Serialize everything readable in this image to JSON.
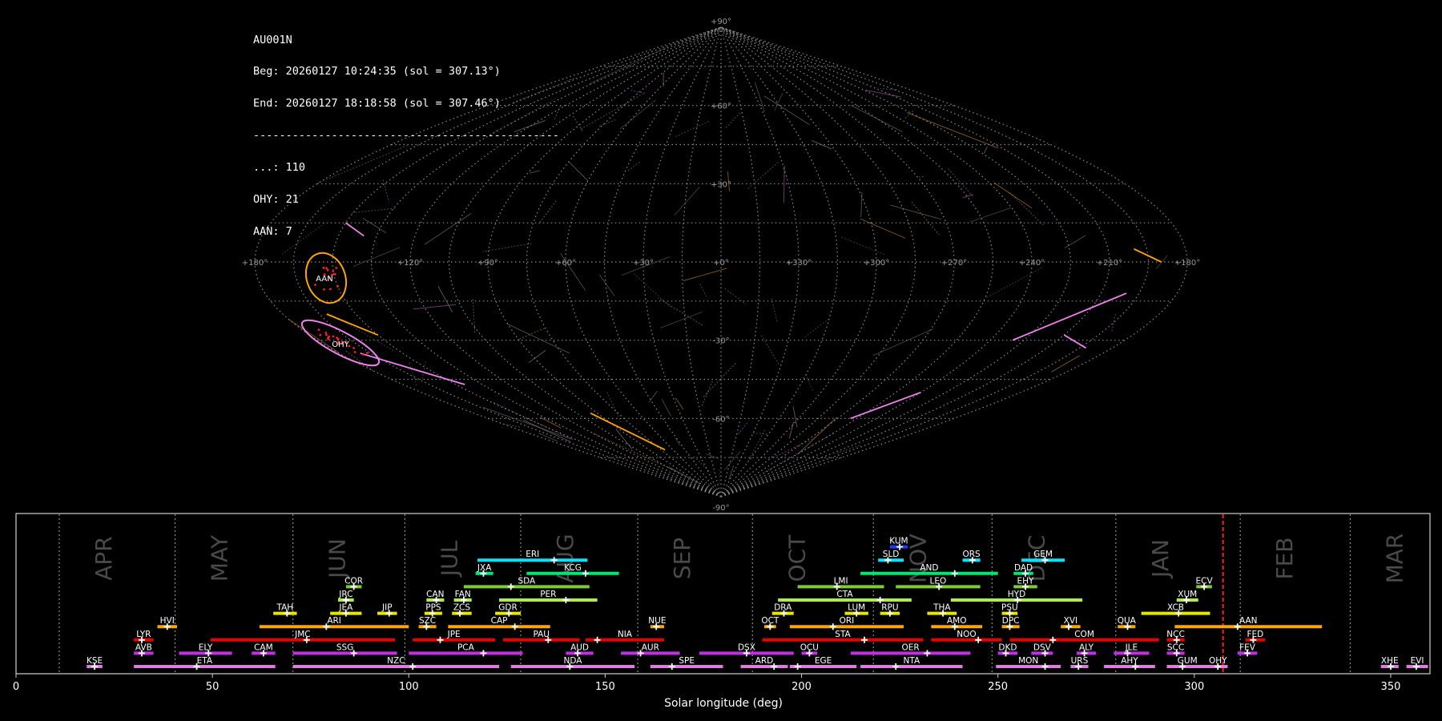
{
  "info": {
    "station": "AU001N",
    "begin": "Beg: 20260127 10:24:35 (sol = 307.13°)",
    "end": "End: 20260127 18:18:58 (sol = 307.46°)",
    "separator": "-----------------------------------------------",
    "counts": [
      "...: 110",
      "OHY: 21",
      "AAN: 7"
    ]
  },
  "sky_map": {
    "projection": "sinusoidal",
    "lon_labels": [
      "+180°",
      "+120°",
      "+90°",
      "+60°",
      "+30°",
      "+0°",
      "+330°",
      "+300°",
      "+270°",
      "+240°",
      "+210°",
      "+180°"
    ],
    "lat_labels": [
      "+90°",
      "+60°",
      "+30°",
      "-30°",
      "-60°",
      "-90°"
    ],
    "shower_markers": [
      {
        "code": "AAN",
        "color": "#ffa500"
      },
      {
        "code": "OHY",
        "color": "#ee82ee"
      }
    ]
  },
  "chart_data": {
    "type": "timeline",
    "xlabel": "Solar longitude (deg)",
    "xlim": [
      0,
      360
    ],
    "xticks": [
      0,
      50,
      100,
      150,
      200,
      250,
      300,
      350
    ],
    "current_sol": 307.3,
    "months": [
      {
        "name": "APR",
        "start": 11
      },
      {
        "name": "MAY",
        "start": 40.5
      },
      {
        "name": "JUN",
        "start": 70.5
      },
      {
        "name": "JUL",
        "start": 99
      },
      {
        "name": "AUG",
        "start": 128.5
      },
      {
        "name": "SEP",
        "start": 158.3
      },
      {
        "name": "OCT",
        "start": 187.5
      },
      {
        "name": "NOV",
        "start": 218.3
      },
      {
        "name": "DEC",
        "start": 248.5
      },
      {
        "name": "JAN",
        "start": 280
      },
      {
        "name": "FEB",
        "start": 311.7
      },
      {
        "name": "MAR",
        "start": 339.7
      }
    ],
    "showers": [
      {
        "code": "KUM",
        "start": 222.5,
        "end": 227,
        "peak": 225,
        "row": 10,
        "color": "#1e3cff"
      },
      {
        "code": "ERI",
        "start": 117.5,
        "end": 145.5,
        "peak": 137,
        "row": 9,
        "color": "#00e5ff"
      },
      {
        "code": "SLD",
        "start": 219.5,
        "end": 226,
        "peak": 222,
        "row": 9,
        "color": "#00e5ff"
      },
      {
        "code": "ORS",
        "start": 241,
        "end": 245.5,
        "peak": 243.5,
        "row": 9,
        "color": "#00e5ff"
      },
      {
        "code": "GEM",
        "start": 256,
        "end": 267,
        "peak": 262,
        "row": 9,
        "color": "#00e5ff"
      },
      {
        "code": "JXA",
        "start": 117,
        "end": 121.5,
        "peak": 119,
        "row": 8,
        "color": "#00e676"
      },
      {
        "code": "KCG",
        "start": 130,
        "end": 153.5,
        "peak": 145,
        "row": 8,
        "color": "#00e676"
      },
      {
        "code": "AND",
        "start": 215,
        "end": 250,
        "peak": 239,
        "row": 8,
        "color": "#00e676"
      },
      {
        "code": "DAD",
        "start": 254,
        "end": 259,
        "peak": 257,
        "row": 8,
        "color": "#00e676"
      },
      {
        "code": "COR",
        "start": 84,
        "end": 88,
        "peak": 86,
        "row": 7,
        "color": "#7ccd32"
      },
      {
        "code": "SDA",
        "start": 114,
        "end": 146,
        "peak": 126,
        "row": 7,
        "color": "#7ccd32"
      },
      {
        "code": "LMI",
        "start": 199,
        "end": 221,
        "peak": 209,
        "row": 7,
        "color": "#7ccd32"
      },
      {
        "code": "LEO",
        "start": 224,
        "end": 245.5,
        "peak": 235,
        "row": 7,
        "color": "#7ccd32"
      },
      {
        "code": "EHY",
        "start": 254,
        "end": 260,
        "peak": 257,
        "row": 7,
        "color": "#7ccd32"
      },
      {
        "code": "ECV",
        "start": 300.5,
        "end": 304.5,
        "peak": 302.5,
        "row": 7,
        "color": "#7ccd32"
      },
      {
        "code": "JRC",
        "start": 82,
        "end": 86,
        "peak": 84,
        "row": 6,
        "color": "#a8f045"
      },
      {
        "code": "CAN",
        "start": 104.5,
        "end": 109,
        "peak": 107,
        "row": 6,
        "color": "#a8f045"
      },
      {
        "code": "FAN",
        "start": 111.5,
        "end": 116,
        "peak": 114,
        "row": 6,
        "color": "#a8f045"
      },
      {
        "code": "PER",
        "start": 123,
        "end": 148,
        "peak": 140,
        "row": 6,
        "color": "#a8f045"
      },
      {
        "code": "CTA",
        "start": 194,
        "end": 228,
        "peak": 220,
        "row": 6,
        "color": "#a8f045"
      },
      {
        "code": "HYD",
        "start": 238,
        "end": 271.5,
        "peak": 255,
        "row": 6,
        "color": "#a8f045"
      },
      {
        "code": "XUM",
        "start": 295.5,
        "end": 301,
        "peak": 298,
        "row": 6,
        "color": "#a8f045"
      },
      {
        "code": "TAH",
        "start": 65.5,
        "end": 71.5,
        "peak": 69,
        "row": 5,
        "color": "#e6e600"
      },
      {
        "code": "JEA",
        "start": 80,
        "end": 88,
        "peak": 84,
        "row": 5,
        "color": "#e6e600"
      },
      {
        "code": "JIP",
        "start": 92,
        "end": 97,
        "peak": 95,
        "row": 5,
        "color": "#e6e600"
      },
      {
        "code": "PPS",
        "start": 104,
        "end": 108.5,
        "peak": 106,
        "row": 5,
        "color": "#e6e600"
      },
      {
        "code": "ZCS",
        "start": 111,
        "end": 116,
        "peak": 113,
        "row": 5,
        "color": "#e6e600"
      },
      {
        "code": "GDR",
        "start": 122,
        "end": 128.5,
        "peak": 125.5,
        "row": 5,
        "color": "#e6e600"
      },
      {
        "code": "DRA",
        "start": 192.5,
        "end": 198,
        "peak": 195.5,
        "row": 5,
        "color": "#e6e600"
      },
      {
        "code": "LUM",
        "start": 211,
        "end": 217,
        "peak": 214,
        "row": 5,
        "color": "#e6e600"
      },
      {
        "code": "RPU",
        "start": 220,
        "end": 225,
        "peak": 222.5,
        "row": 5,
        "color": "#e6e600"
      },
      {
        "code": "THA",
        "start": 232,
        "end": 239.5,
        "peak": 236,
        "row": 5,
        "color": "#e6e600"
      },
      {
        "code": "PSU",
        "start": 251,
        "end": 255,
        "peak": 253,
        "row": 5,
        "color": "#e6e600"
      },
      {
        "code": "XCB",
        "start": 286.5,
        "end": 304,
        "peak": 296,
        "row": 5,
        "color": "#e6e600"
      },
      {
        "code": "HVI",
        "start": 36,
        "end": 41,
        "peak": 38.5,
        "row": 4,
        "color": "#ffa500"
      },
      {
        "code": "ARI",
        "start": 62,
        "end": 100,
        "peak": 79,
        "row": 4,
        "color": "#ffa500"
      },
      {
        "code": "SZC",
        "start": 102.5,
        "end": 107,
        "peak": 104.5,
        "row": 4,
        "color": "#ffa500"
      },
      {
        "code": "CAP",
        "start": 110,
        "end": 136,
        "peak": 127,
        "row": 4,
        "color": "#ffa500"
      },
      {
        "code": "NUE",
        "start": 161.5,
        "end": 165,
        "peak": 163,
        "row": 4,
        "color": "#ffa500"
      },
      {
        "code": "OCT",
        "start": 190.5,
        "end": 193.5,
        "peak": 192,
        "row": 4,
        "color": "#ffa500"
      },
      {
        "code": "ORI",
        "start": 197,
        "end": 226,
        "peak": 208,
        "row": 4,
        "color": "#ffa500"
      },
      {
        "code": "AMO",
        "start": 233,
        "end": 246,
        "peak": 239,
        "row": 4,
        "color": "#ffa500"
      },
      {
        "code": "DPC",
        "start": 251,
        "end": 255.5,
        "peak": 253,
        "row": 4,
        "color": "#ffa500"
      },
      {
        "code": "XVI",
        "start": 266,
        "end": 271,
        "peak": 268,
        "row": 4,
        "color": "#ffa500"
      },
      {
        "code": "QUA",
        "start": 280.5,
        "end": 285,
        "peak": 283,
        "row": 4,
        "color": "#ffa500"
      },
      {
        "code": "AAN",
        "start": 295,
        "end": 332.5,
        "peak": 311,
        "row": 4,
        "color": "#ffa500"
      },
      {
        "code": "LYR",
        "start": 30,
        "end": 35,
        "peak": 32,
        "row": 3,
        "color": "#e60000"
      },
      {
        "code": "JMC",
        "start": 49.5,
        "end": 96.5,
        "peak": 74,
        "row": 3,
        "color": "#e60000"
      },
      {
        "code": "JPE",
        "start": 101,
        "end": 122,
        "peak": 108,
        "row": 3,
        "color": "#e60000"
      },
      {
        "code": "PAU",
        "start": 124,
        "end": 143.5,
        "peak": 135.5,
        "row": 3,
        "color": "#e60000"
      },
      {
        "code": "NIA",
        "start": 145,
        "end": 165,
        "peak": 148,
        "row": 3,
        "color": "#e60000"
      },
      {
        "code": "STA",
        "start": 190,
        "end": 231,
        "peak": 216,
        "row": 3,
        "color": "#e60000"
      },
      {
        "code": "NOO",
        "start": 233,
        "end": 251,
        "peak": 245,
        "row": 3,
        "color": "#e60000"
      },
      {
        "code": "COM",
        "start": 253,
        "end": 291,
        "peak": 264,
        "row": 3,
        "color": "#e60000"
      },
      {
        "code": "NCC",
        "start": 293,
        "end": 297.5,
        "peak": 295.5,
        "row": 3,
        "color": "#e60000"
      },
      {
        "code": "FED",
        "start": 313,
        "end": 318,
        "peak": 315,
        "row": 3,
        "color": "#e60000"
      },
      {
        "code": "AVB",
        "start": 30,
        "end": 35,
        "peak": 32,
        "row": 2,
        "color": "#c030e0"
      },
      {
        "code": "ELY",
        "start": 41.5,
        "end": 55,
        "peak": 49,
        "row": 2,
        "color": "#c030e0"
      },
      {
        "code": "CAM",
        "start": 60,
        "end": 66,
        "peak": 63,
        "row": 2,
        "color": "#c030e0"
      },
      {
        "code": "SSG",
        "start": 70.5,
        "end": 97,
        "peak": 86,
        "row": 2,
        "color": "#c030e0"
      },
      {
        "code": "PCA",
        "start": 100,
        "end": 129,
        "peak": 119,
        "row": 2,
        "color": "#c030e0"
      },
      {
        "code": "AUD",
        "start": 140,
        "end": 147,
        "peak": 143,
        "row": 2,
        "color": "#c030e0"
      },
      {
        "code": "AUR",
        "start": 154,
        "end": 169,
        "peak": 159,
        "row": 2,
        "color": "#c030e0"
      },
      {
        "code": "DSX",
        "start": 174,
        "end": 198,
        "peak": 186,
        "row": 2,
        "color": "#c030e0"
      },
      {
        "code": "OCU",
        "start": 200,
        "end": 204,
        "peak": 202,
        "row": 2,
        "color": "#c030e0"
      },
      {
        "code": "OER",
        "start": 212.5,
        "end": 243,
        "peak": 232,
        "row": 2,
        "color": "#c030e0"
      },
      {
        "code": "DKD",
        "start": 250,
        "end": 255,
        "peak": 252,
        "row": 2,
        "color": "#c030e0"
      },
      {
        "code": "DSV",
        "start": 258.5,
        "end": 264,
        "peak": 262,
        "row": 2,
        "color": "#c030e0"
      },
      {
        "code": "ALY",
        "start": 270,
        "end": 275,
        "peak": 272,
        "row": 2,
        "color": "#c030e0"
      },
      {
        "code": "JLE",
        "start": 279.5,
        "end": 288.5,
        "peak": 283,
        "row": 2,
        "color": "#c030e0"
      },
      {
        "code": "SCC",
        "start": 293,
        "end": 297.5,
        "peak": 295.5,
        "row": 2,
        "color": "#c030e0"
      },
      {
        "code": "FEV",
        "start": 311,
        "end": 316,
        "peak": 313.5,
        "row": 2,
        "color": "#c030e0"
      },
      {
        "code": "KSE",
        "start": 18,
        "end": 22,
        "peak": 20,
        "row": 1,
        "color": "#e279e2"
      },
      {
        "code": "ETA",
        "start": 30,
        "end": 66,
        "peak": 46,
        "row": 1,
        "color": "#e279e2"
      },
      {
        "code": "NZC",
        "start": 70.5,
        "end": 123,
        "peak": 101,
        "row": 1,
        "color": "#e279e2"
      },
      {
        "code": "NDA",
        "start": 126,
        "end": 157.5,
        "peak": 141,
        "row": 1,
        "color": "#e279e2"
      },
      {
        "code": "SPE",
        "start": 161.5,
        "end": 180,
        "peak": 167,
        "row": 1,
        "color": "#e279e2"
      },
      {
        "code": "ARD",
        "start": 184.5,
        "end": 196.5,
        "peak": 193,
        "row": 1,
        "color": "#e279e2"
      },
      {
        "code": "EGE",
        "start": 197,
        "end": 214,
        "peak": 199,
        "row": 1,
        "color": "#e279e2"
      },
      {
        "code": "NTA",
        "start": 215,
        "end": 241,
        "peak": 224,
        "row": 1,
        "color": "#e279e2"
      },
      {
        "code": "MON",
        "start": 249.5,
        "end": 266,
        "peak": 262,
        "row": 1,
        "color": "#e279e2"
      },
      {
        "code": "URS",
        "start": 268.5,
        "end": 273,
        "peak": 270.5,
        "row": 1,
        "color": "#e279e2"
      },
      {
        "code": "AHY",
        "start": 277,
        "end": 290,
        "peak": 285,
        "row": 1,
        "color": "#e279e2"
      },
      {
        "code": "GUM",
        "start": 293,
        "end": 303.5,
        "peak": 297,
        "row": 1,
        "color": "#e279e2"
      },
      {
        "code": "OHY",
        "start": 303.5,
        "end": 308.5,
        "peak": 306,
        "row": 1,
        "color": "#e279e2"
      },
      {
        "code": "XHE",
        "start": 347.5,
        "end": 352,
        "peak": 350,
        "row": 1,
        "color": "#e279e2"
      },
      {
        "code": "EVI",
        "start": 354,
        "end": 359.5,
        "peak": 356.5,
        "row": 1,
        "color": "#e279e2"
      }
    ]
  }
}
